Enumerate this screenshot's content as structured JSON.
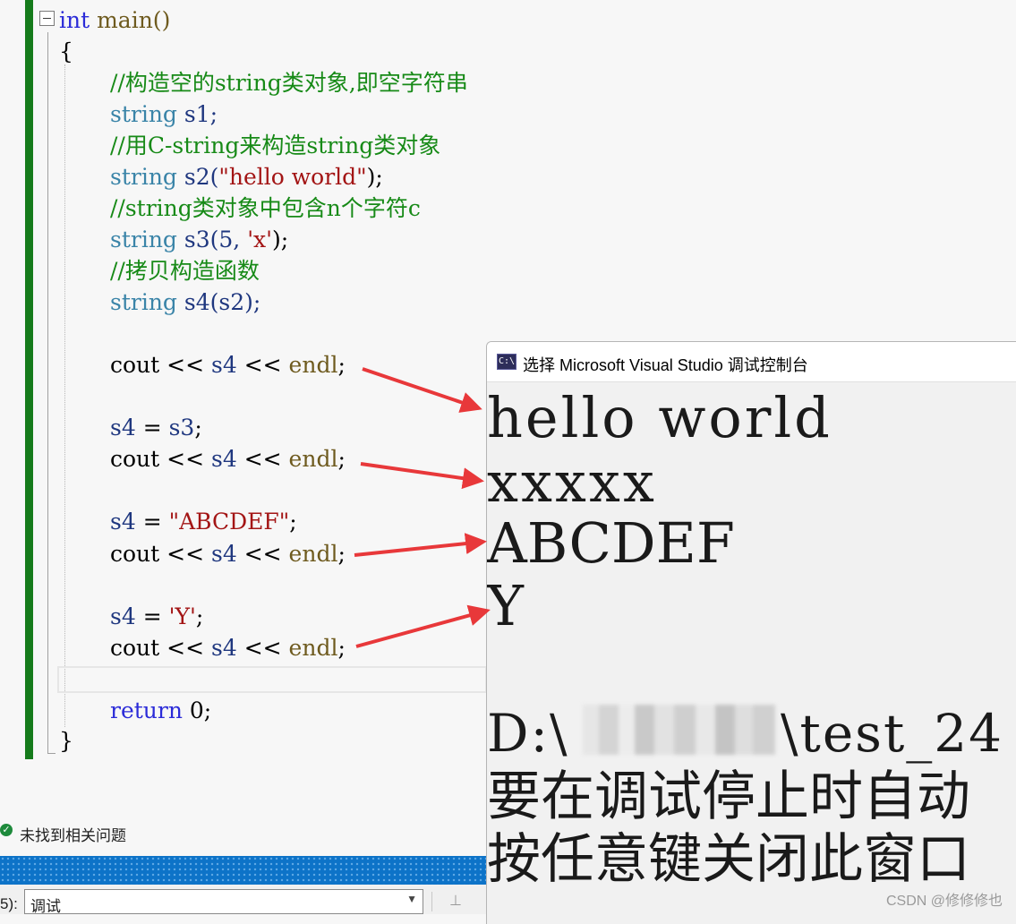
{
  "editor": {
    "lines": {
      "l1_kw": "int",
      "l1_rest": " main()",
      "l2": "{",
      "l3": "//构造空的string类对象,即空字符串",
      "l4_type": "string",
      "l4_rest": " s1;",
      "l5": "//用C-string来构造string类对象",
      "l6_type": "string",
      "l6_id": " s2(",
      "l6_str": "\"hello world\"",
      "l6_end": ");",
      "l7": "//string类对象中包含n个字符c",
      "l8_type": "string",
      "l8_id": " s3(5, ",
      "l8_str": "'x'",
      "l8_end": ");",
      "l9": "//拷贝构造函数",
      "l10_type": "string",
      "l10_rest": " s4(s2);",
      "cout": "cout",
      "op": " << ",
      "s4": "s4",
      "endl": "endl",
      "semi": ";",
      "assign_s3_id": "s4",
      "assign_s3_op": " = ",
      "assign_s3_rhs": "s3",
      "assign_str_lhs": "s4",
      "assign_str_op": " = ",
      "assign_str_rhs": "\"ABCDEF\"",
      "assign_chr_lhs": "s4",
      "assign_chr_op": " = ",
      "assign_chr_rhs": "'Y'",
      "ret_kw": "return",
      "ret_rest": " 0;",
      "close": "}"
    }
  },
  "status": {
    "text": "未找到相关问题"
  },
  "output_toolbar": {
    "label": "5):",
    "select_value": "调试"
  },
  "console": {
    "title": "选择 Microsoft Visual Studio 调试控制台",
    "icon_text": "C:\\",
    "output": [
      "hello world",
      "xxxxx",
      "ABCDEF",
      "Y"
    ],
    "path_prefix": "D:\\",
    "path_suffix": "\\test_24",
    "msg1": "要在调试停止时自动",
    "msg2": "按任意键关闭此窗口"
  },
  "watermark": "CSDN @修修修也",
  "colors": {
    "change_bar": "#157b1b",
    "arrow": "#e8383a",
    "keyword": "#2b2bd8",
    "type": "#3a84a8",
    "comment": "#178a17",
    "string": "#a31515"
  }
}
